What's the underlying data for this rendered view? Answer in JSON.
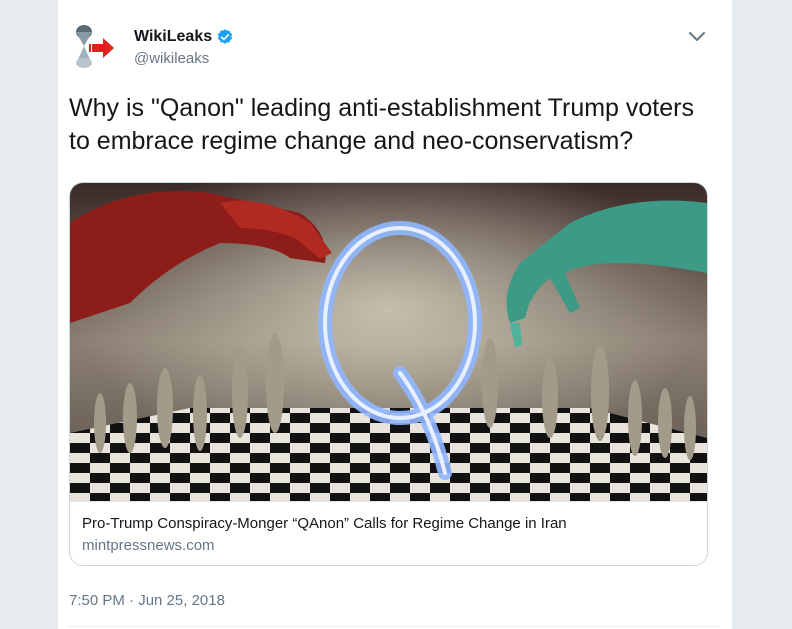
{
  "account": {
    "display_name": "WikiLeaks",
    "handle": "@wikileaks",
    "verified": true,
    "avatar_icon": "wikileaks-hourglass-logo",
    "verified_icon": "verified-badge-icon",
    "menu_icon": "chevron-down-icon"
  },
  "tweet": {
    "text": "Why is \"Qanon\" leading anti-establishment Trump voters to embrace regime change and neo-conservatism?",
    "timestamp": "7:50 PM · Jun 25, 2018"
  },
  "card": {
    "title": "Pro-Trump Conspiracy-Monger “QAnon” Calls for Regime Change in Iran",
    "domain": "mintpressnews.com",
    "image_icon": "q-chessboard-illustration"
  },
  "colors": {
    "verified_blue": "#1da1f2",
    "text": "#14171a",
    "secondary": "#657786",
    "border": "#ccd6dd",
    "arrow_red": "#e0201b"
  }
}
